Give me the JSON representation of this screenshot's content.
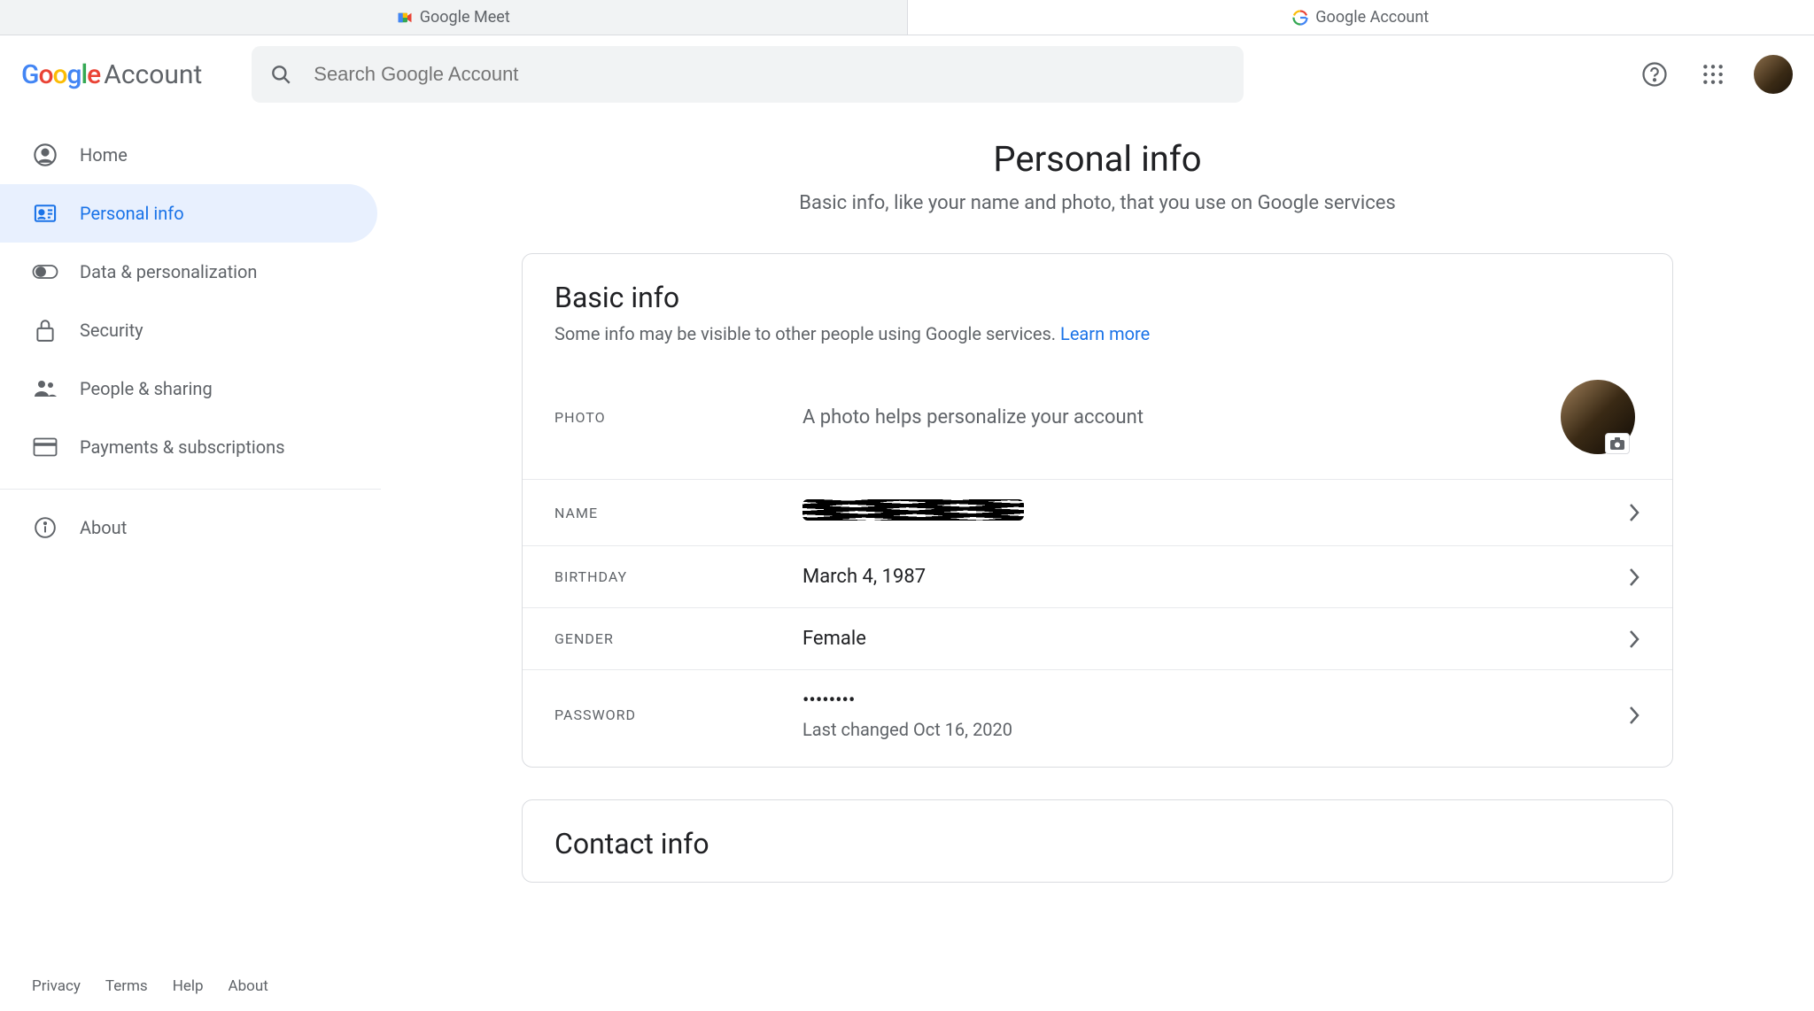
{
  "tabs": [
    {
      "label": "Google Meet"
    },
    {
      "label": "Google Account"
    }
  ],
  "logo": {
    "google": "Google",
    "account": "Account"
  },
  "search": {
    "placeholder": "Search Google Account"
  },
  "sidebar": {
    "items": [
      {
        "label": "Home"
      },
      {
        "label": "Personal info"
      },
      {
        "label": "Data & personalization"
      },
      {
        "label": "Security"
      },
      {
        "label": "People & sharing"
      },
      {
        "label": "Payments & subscriptions"
      }
    ],
    "about": "About"
  },
  "footer": {
    "privacy": "Privacy",
    "terms": "Terms",
    "help": "Help",
    "about": "About"
  },
  "page": {
    "title": "Personal info",
    "subtitle": "Basic info, like your name and photo, that you use on Google services"
  },
  "basic_info": {
    "title": "Basic info",
    "subtitle": "Some info may be visible to other people using Google services. ",
    "learn_more": "Learn more",
    "rows": {
      "photo": {
        "label": "PHOTO",
        "desc": "A photo helps personalize your account"
      },
      "name": {
        "label": "NAME"
      },
      "birthday": {
        "label": "BIRTHDAY",
        "value": "March 4, 1987"
      },
      "gender": {
        "label": "GENDER",
        "value": "Female"
      },
      "password": {
        "label": "PASSWORD",
        "value": "••••••••",
        "sub": "Last changed Oct 16, 2020"
      }
    }
  },
  "contact_info": {
    "title": "Contact info"
  }
}
